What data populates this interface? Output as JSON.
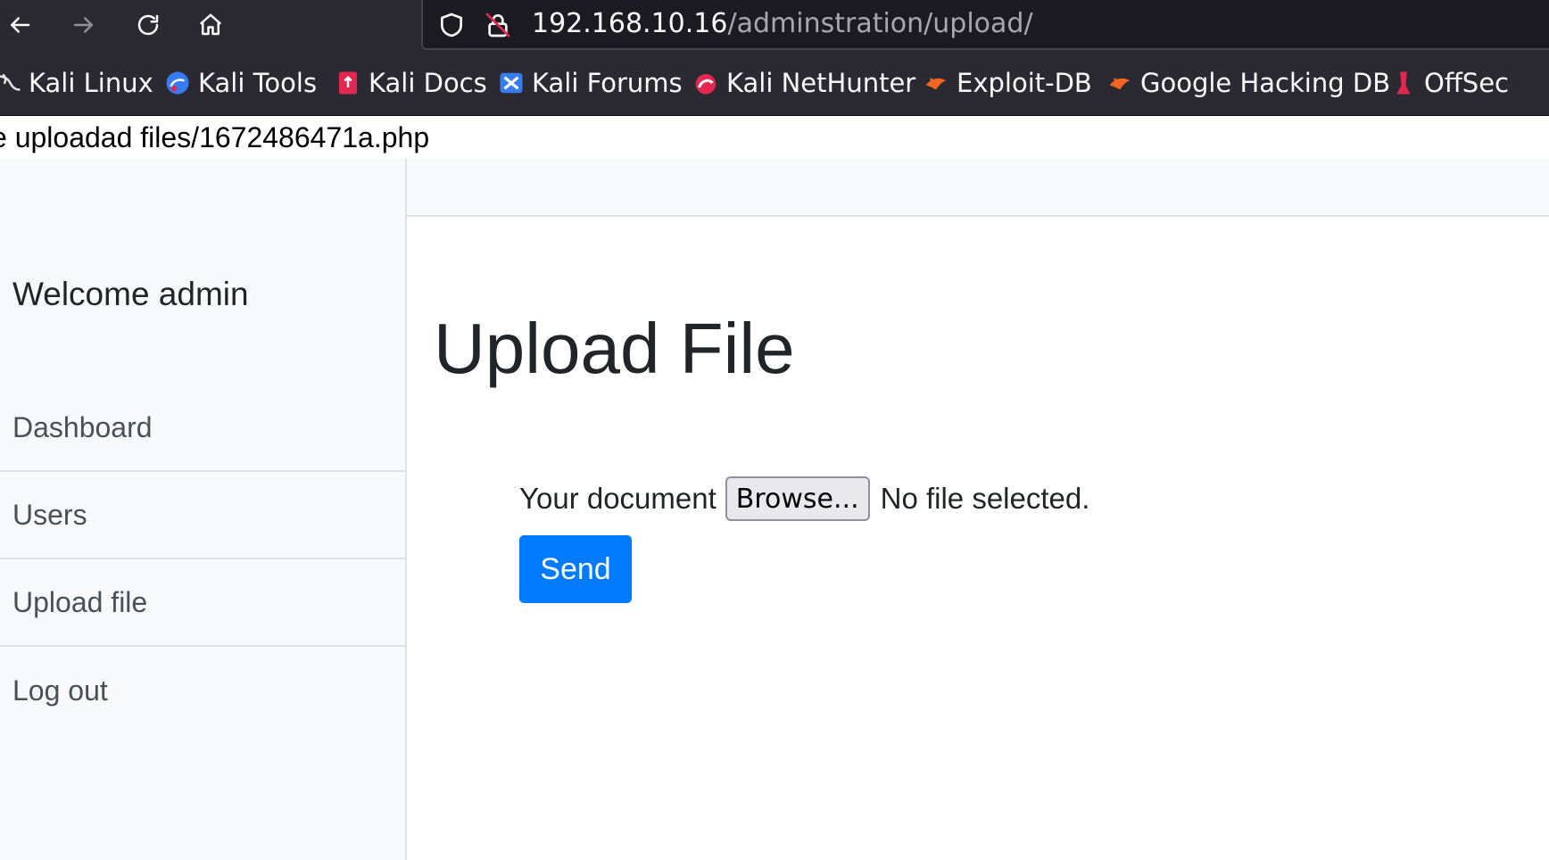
{
  "browser": {
    "url_host": "192.168.10.16",
    "url_path": "/adminstration/upload/",
    "icons": {
      "back": "arrow-left-icon",
      "forward": "arrow-right-icon",
      "reload": "reload-icon",
      "home": "home-icon",
      "shield": "shield-icon",
      "insecure_lock": "insecure-lock-icon"
    },
    "bookmarks": [
      {
        "label": "Kali Linux",
        "icon": "kali-dragon-icon"
      },
      {
        "label": "Kali Tools",
        "icon": "kali-tools-icon"
      },
      {
        "label": "Kali Docs",
        "icon": "kali-docs-icon"
      },
      {
        "label": "Kali Forums",
        "icon": "kali-forums-icon"
      },
      {
        "label": "Kali NetHunter",
        "icon": "kali-nethunter-icon"
      },
      {
        "label": "Exploit-DB",
        "icon": "exploit-db-icon"
      },
      {
        "label": "Google Hacking DB",
        "icon": "ghdb-icon"
      },
      {
        "label": "OffSec",
        "icon": "offsec-icon"
      }
    ]
  },
  "page": {
    "upload_message": "e uploadad files/1672486471a.php",
    "sidebar": {
      "welcome": "Welcome admin",
      "items": [
        {
          "label": "Dashboard"
        },
        {
          "label": "Users"
        },
        {
          "label": "Upload file"
        },
        {
          "label": "Log out"
        }
      ]
    },
    "main": {
      "title": "Upload File",
      "form": {
        "label": "Your document",
        "browse_label": "Browse...",
        "file_status": "No file selected.",
        "send_label": "Send"
      }
    }
  },
  "colors": {
    "chrome_bg": "#2b2a33",
    "urlbar_bg": "#1c1b22",
    "sidebar_bg": "#f8f9fa",
    "primary": "#007bff",
    "text": "#212529",
    "muted_text": "#495057"
  }
}
